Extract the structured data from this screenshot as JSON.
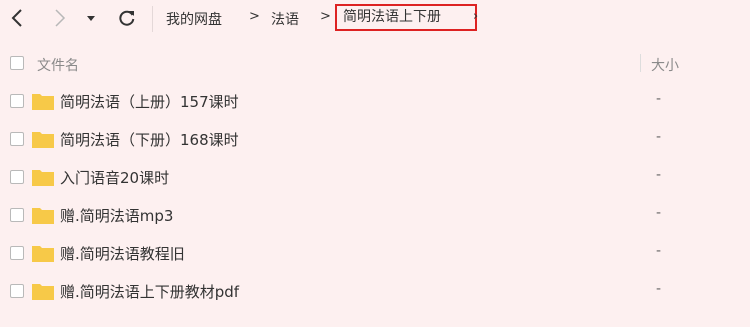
{
  "toolbar": {
    "breadcrumb": [
      "我的网盘",
      "法语",
      "简明法语上下册"
    ],
    "crumb_separator": ">",
    "after_current": "›"
  },
  "list": {
    "columns": {
      "name": "文件名",
      "size": "大小"
    },
    "rows": [
      {
        "name": "简明法语（上册）157课时",
        "size": "-"
      },
      {
        "name": "简明法语（下册）168课时",
        "size": "-"
      },
      {
        "name": "入门语音20课时",
        "size": "-"
      },
      {
        "name": "赠.简明法语mp3",
        "size": "-"
      },
      {
        "name": "赠.简明法语教程旧",
        "size": "-"
      },
      {
        "name": "赠.简明法语上下册教材pdf",
        "size": "-"
      }
    ]
  },
  "colors": {
    "background": "#fdf0f0",
    "folder": "#f7c948",
    "highlight_border": "#dd2222"
  },
  "icons": [
    "back-arrow-icon",
    "forward-arrow-icon",
    "dropdown-caret-icon",
    "refresh-icon",
    "folder-icon"
  ]
}
